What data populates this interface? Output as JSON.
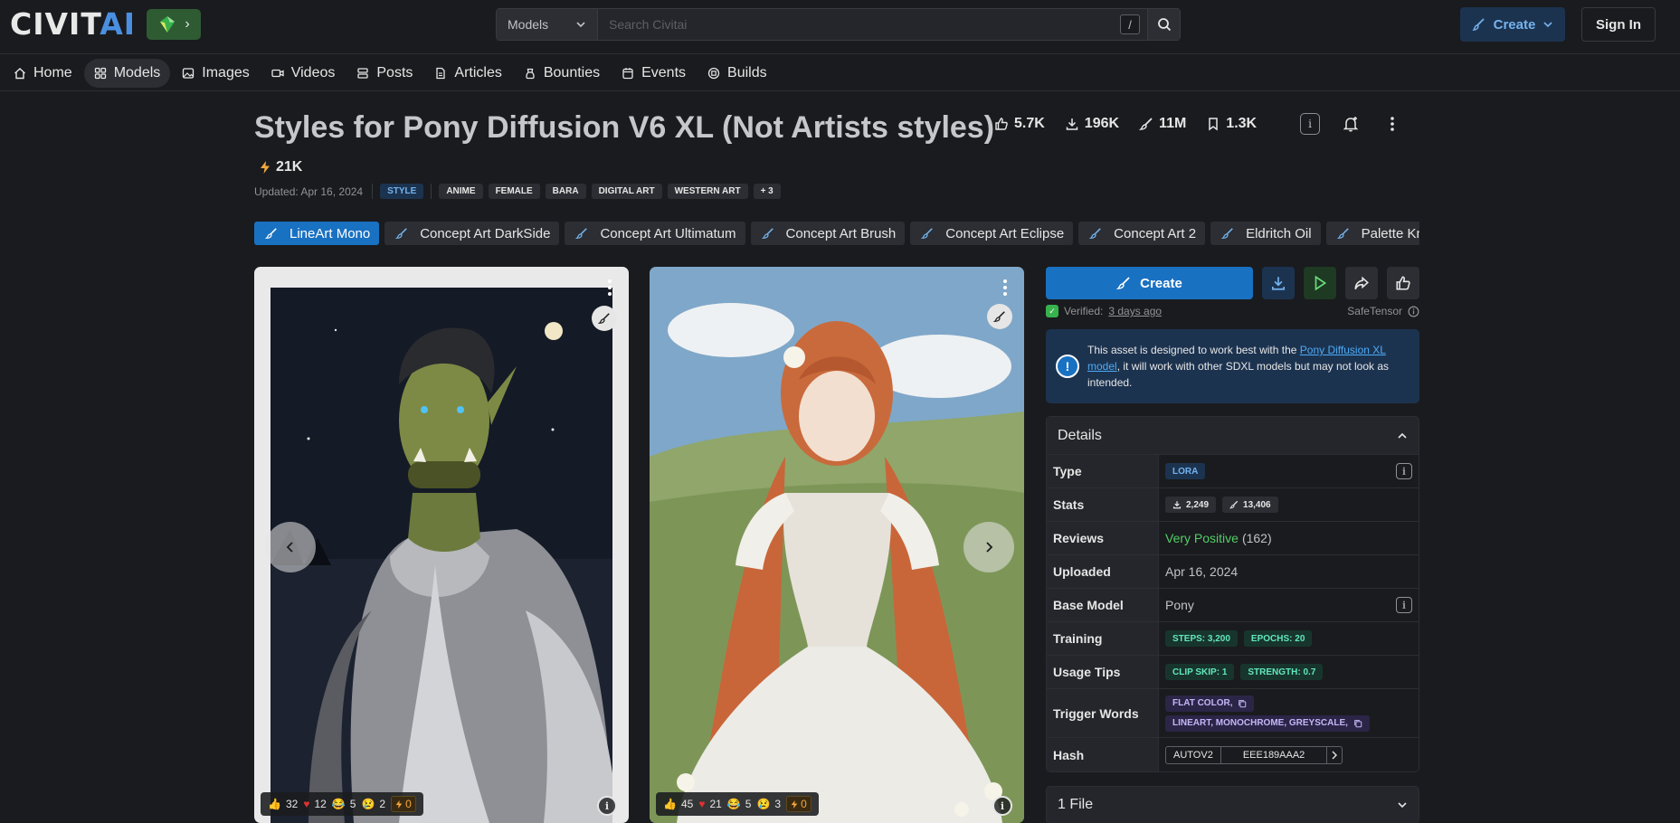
{
  "header": {
    "logo_main": "CIVIT",
    "logo_accent": "AI",
    "search": {
      "type": "Models",
      "placeholder": "Search Civitai",
      "shortcut": "/"
    },
    "create_label": "Create",
    "signin_label": "Sign In"
  },
  "nav": [
    {
      "label": "Home",
      "icon": "home-icon"
    },
    {
      "label": "Models",
      "icon": "grid-icon",
      "active": true
    },
    {
      "label": "Images",
      "icon": "image-icon"
    },
    {
      "label": "Videos",
      "icon": "video-icon"
    },
    {
      "label": "Posts",
      "icon": "posts-icon"
    },
    {
      "label": "Articles",
      "icon": "article-icon"
    },
    {
      "label": "Bounties",
      "icon": "bounty-icon"
    },
    {
      "label": "Events",
      "icon": "calendar-icon"
    },
    {
      "label": "Builds",
      "icon": "cpu-icon"
    }
  ],
  "model": {
    "title": "Styles for Pony Diffusion V6 XL (Not Artists styles)",
    "stats": {
      "likes": "5.7K",
      "downloads": "196K",
      "generations": "11M",
      "bookmarks": "1.3K"
    },
    "buzz": "21K",
    "updated": "Updated: Apr 16, 2024",
    "type_tag": "STYLE",
    "tags": [
      "ANIME",
      "FEMALE",
      "BARA",
      "DIGITAL ART",
      "WESTERN ART",
      "+ 3"
    ]
  },
  "versions": [
    "LineArt Mono",
    "Concept Art DarkSide",
    "Concept Art Ultimatum",
    "Concept Art Brush",
    "Concept Art Eclipse",
    "Concept Art 2",
    "Eldritch Oil",
    "Palette Knife"
  ],
  "gallery": [
    {
      "reactions": {
        "like": "32",
        "heart": "12",
        "laugh": "5",
        "cry": "2",
        "buzz": "0"
      }
    },
    {
      "reactions": {
        "like": "45",
        "heart": "21",
        "laugh": "5",
        "cry": "3",
        "buzz": "0"
      }
    }
  ],
  "sidebar": {
    "create_label": "Create",
    "verified_label": "Verified:",
    "verified_when": "3 days ago",
    "safetensor": "SafeTensor",
    "notice": {
      "before": "This asset is designed to work best with the ",
      "link": "Pony Diffusion XL model",
      "after": ", it will work with other SDXL models but may not look as intended."
    },
    "details_title": "Details",
    "details": {
      "type_label": "Type",
      "type_value": "LORA",
      "stats_label": "Stats",
      "stats_downloads": "2,249",
      "stats_generations": "13,406",
      "reviews_label": "Reviews",
      "reviews_value": "Very Positive",
      "reviews_count": "(162)",
      "uploaded_label": "Uploaded",
      "uploaded_value": "Apr 16, 2024",
      "base_label": "Base Model",
      "base_value": "Pony",
      "training_label": "Training",
      "training_steps": "STEPS: 3,200",
      "training_epochs": "EPOCHS: 20",
      "tips_label": "Usage Tips",
      "tips_clip": "CLIP SKIP: 1",
      "tips_strength": "STRENGTH: 0.7",
      "trigger_label": "Trigger Words",
      "trigger_1": "FLAT COLOR,",
      "trigger_2": "LINEART, MONOCHROME, GREYSCALE,",
      "hash_label": "Hash",
      "hash_type": "AUTOV2",
      "hash_value": "EEE189AAA2"
    },
    "files_title": "1 File"
  },
  "colors": {
    "accent": "#1971c2",
    "background": "#1a1b1e",
    "positive": "#51cf66"
  }
}
